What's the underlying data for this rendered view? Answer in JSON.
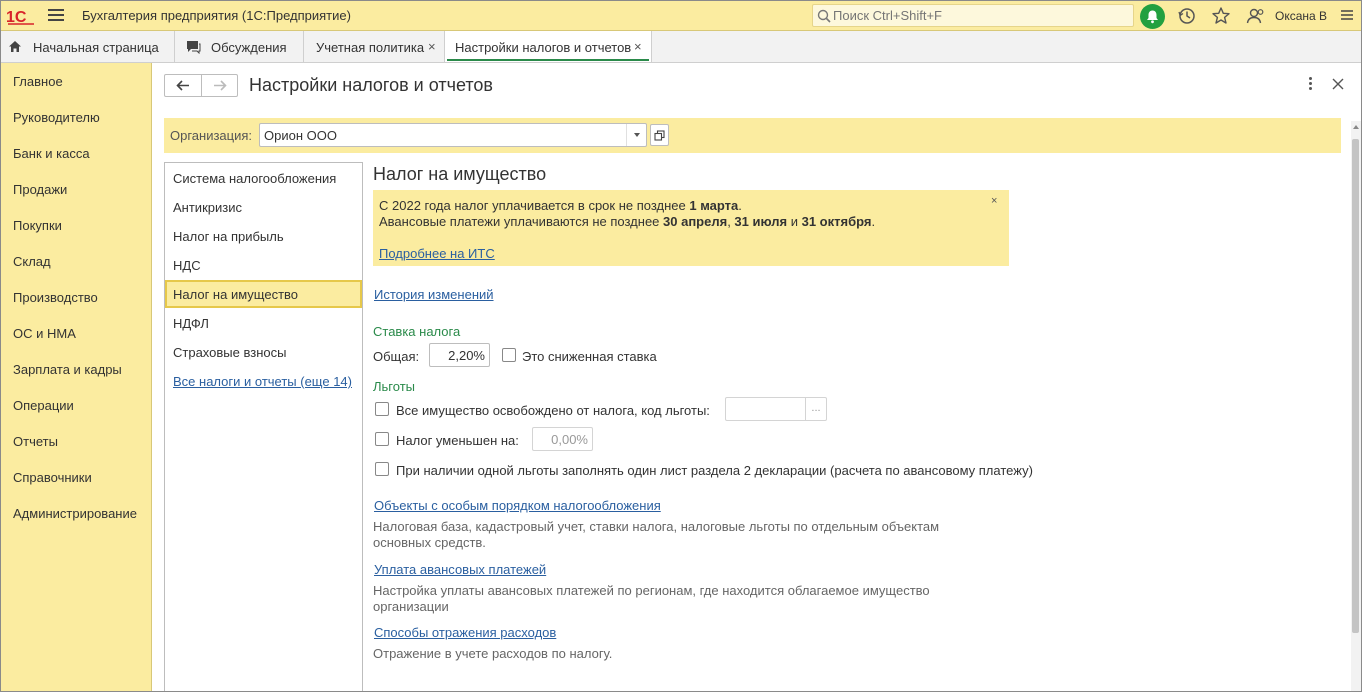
{
  "app": {
    "title": "Бухгалтерия предприятия  (1С:Предприятие)",
    "search_placeholder": "Поиск Ctrl+Shift+F",
    "user": "Оксана В"
  },
  "tabs": [
    {
      "label": "Начальная страница",
      "icon": "home-icon"
    },
    {
      "label": "Обсуждения",
      "icon": "chat-icon"
    },
    {
      "label": "Учетная политика",
      "close": "×"
    },
    {
      "label": "Настройки налогов и отчетов",
      "close": "×",
      "active": true
    }
  ],
  "sidebar": {
    "items": [
      "Главное",
      "Руководителю",
      "Банк и касса",
      "Продажи",
      "Покупки",
      "Склад",
      "Производство",
      "ОС и НМА",
      "Зарплата и кадры",
      "Операции",
      "Отчеты",
      "Справочники",
      "Администрирование"
    ]
  },
  "form": {
    "title": "Настройки налогов и отчетов",
    "org_label": "Организация:",
    "org_value": "Орион ООО"
  },
  "sections": {
    "items": [
      "Система налогообложения",
      "Антикризис",
      "Налог на прибыль",
      "НДС",
      "Налог на имущество",
      "НДФЛ",
      "Страховые взносы"
    ],
    "active_index": 4,
    "all_link": "Все налоги и отчеты (еще 14)"
  },
  "content": {
    "heading": "Налог на имущество",
    "notice": {
      "l1_a": "С 2022 года налог уплачивается в срок не позднее ",
      "l1_b": "1 марта",
      "l1_c": ".",
      "l2_a": "Авансовые платежи уплачиваются не позднее ",
      "l2_b": "30 апреля",
      "l2_c": ", ",
      "l2_d": "31 июля",
      "l2_e": " и ",
      "l2_f": "31 октября",
      "l2_g": ".",
      "link": "Подробнее на ИТС",
      "close": "×"
    },
    "history_link": "История изменений",
    "rate_group": "Ставка налога",
    "rate_label": "Общая:",
    "rate_value": "2,20%",
    "reduced_label": "Это сниженная ставка",
    "benefits_group": "Льготы",
    "exempt_label": "Все имущество освобождено от налога, код льготы:",
    "exempt_btn": "...",
    "reduced_by_label": "Налог уменьшен на:",
    "reduced_by_value": "0,00%",
    "one_sheet_label": "При наличии одной льготы заполнять один лист раздела 2 декларации (расчета по авансовому платежу)",
    "links": [
      {
        "title": "Объекты с особым порядком налогообложения",
        "desc1": "Налоговая база, кадастровый учет, ставки налога, налоговые льготы по отдельным объектам",
        "desc2": "основных средств."
      },
      {
        "title": "Уплата авансовых платежей",
        "desc1": "Настройка уплаты авансовых платежей по регионам, где находится облагаемое имущество",
        "desc2": "организации"
      },
      {
        "title": "Способы отражения расходов",
        "desc1": "Отражение в учете расходов по налогу.",
        "desc2": ""
      }
    ]
  },
  "colors": {
    "accent_yellow": "#fbeca0",
    "link_blue": "#2a5fa0",
    "group_green": "#2a8a4a",
    "logo_red": "#d8232a"
  }
}
